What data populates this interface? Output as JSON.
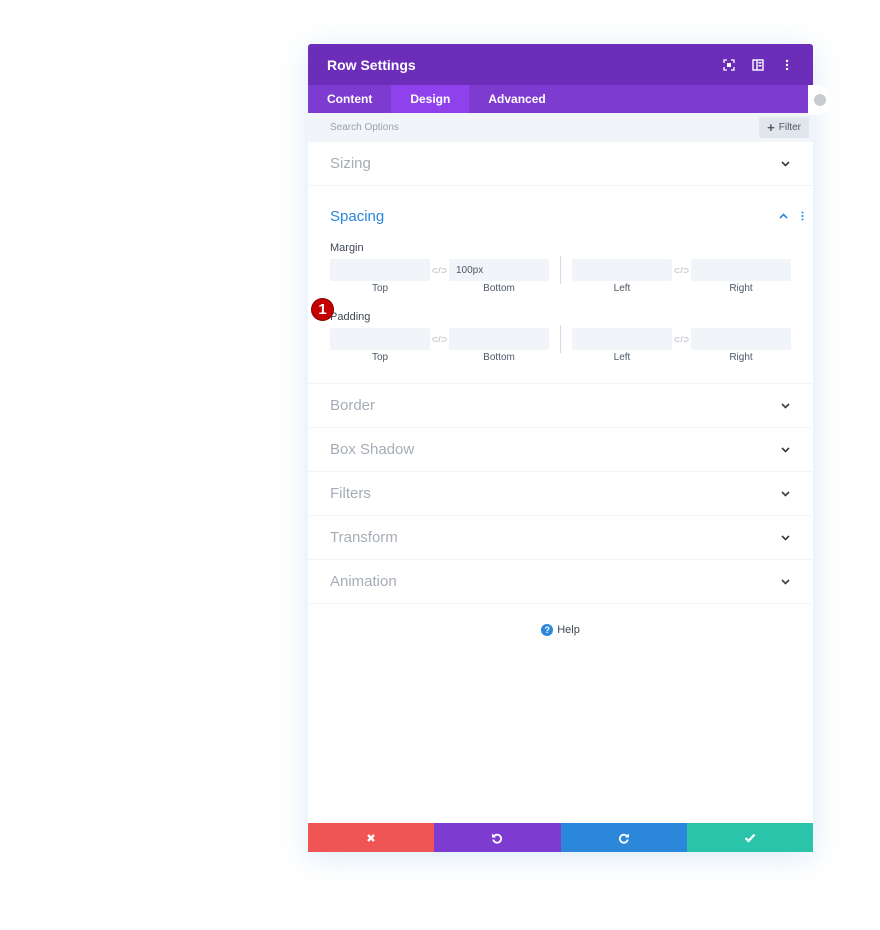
{
  "header": {
    "title": "Row Settings",
    "icons": [
      "focus-icon",
      "split-view-icon",
      "more-options-icon"
    ]
  },
  "tabs": [
    {
      "label": "Content",
      "active": false
    },
    {
      "label": "Design",
      "active": true
    },
    {
      "label": "Advanced",
      "active": false
    }
  ],
  "search": {
    "placeholder": "Search Options",
    "value": "",
    "filter_label": "Filter"
  },
  "sections": {
    "sizing": {
      "title": "Sizing",
      "open": false
    },
    "spacing": {
      "title": "Spacing",
      "open": true,
      "margin": {
        "label": "Margin",
        "top": {
          "label": "Top",
          "value": ""
        },
        "bottom": {
          "label": "Bottom",
          "value": "100px"
        },
        "left": {
          "label": "Left",
          "value": ""
        },
        "right": {
          "label": "Right",
          "value": ""
        }
      },
      "padding": {
        "label": "Padding",
        "top": {
          "label": "Top",
          "value": ""
        },
        "bottom": {
          "label": "Bottom",
          "value": ""
        },
        "left": {
          "label": "Left",
          "value": ""
        },
        "right": {
          "label": "Right",
          "value": ""
        }
      }
    },
    "border": {
      "title": "Border",
      "open": false
    },
    "box_shadow": {
      "title": "Box Shadow",
      "open": false
    },
    "filters": {
      "title": "Filters",
      "open": false
    },
    "transform": {
      "title": "Transform",
      "open": false
    },
    "animation": {
      "title": "Animation",
      "open": false
    }
  },
  "link_glyph": "⊂/⊃",
  "step_badge": "1",
  "help_label": "Help",
  "footer": {
    "buttons": [
      {
        "name": "cancel",
        "color": "#ef5555"
      },
      {
        "name": "undo",
        "color": "#7e3bd0"
      },
      {
        "name": "redo",
        "color": "#2b87da"
      },
      {
        "name": "save",
        "color": "#29c4a9"
      }
    ]
  },
  "colors": {
    "header": "#6c2eb9",
    "tabs": "#7e3bd0",
    "active_tab": "#8f42ec",
    "accent": "#2b87da"
  }
}
